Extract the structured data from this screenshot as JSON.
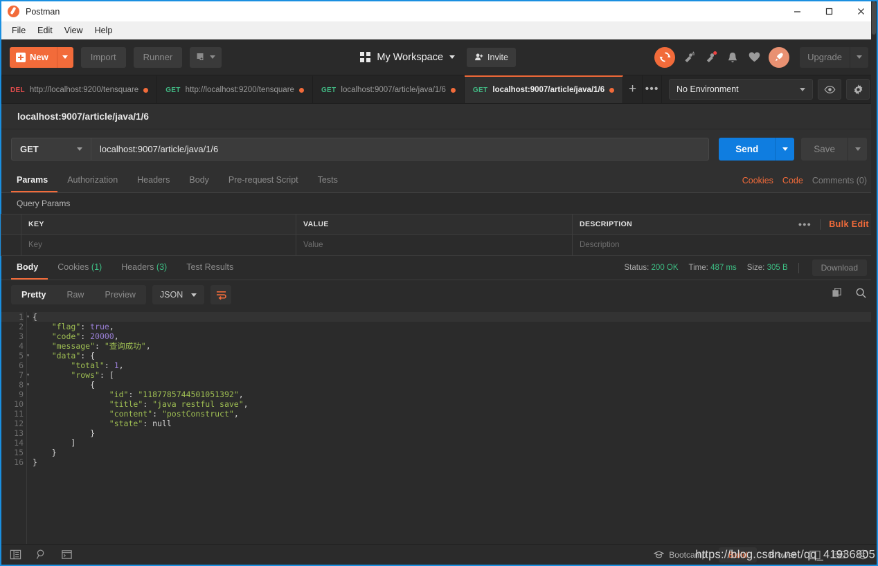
{
  "window": {
    "title": "Postman",
    "logo_icon": "postman-logo-icon",
    "minimize_icon": "minimize-icon",
    "maximize_icon": "maximize-icon",
    "close_icon": "close-icon"
  },
  "menubar": {
    "items": [
      "File",
      "Edit",
      "View",
      "Help"
    ]
  },
  "toolbar": {
    "new_label": "New",
    "new_caret_icon": "chevron-down-icon",
    "import_label": "Import",
    "runner_label": "Runner",
    "new_window_icon": "new-window-icon",
    "workspace_label": "My Workspace",
    "workspace_grid_icon": "grid-icon",
    "workspace_caret_icon": "chevron-down-icon",
    "invite_label": "Invite",
    "invite_icon": "person-add-icon",
    "sync_icon": "sync-icon",
    "satellite_icon": "satellite-icon",
    "notifications_icon": "notification-bell-alert-icon",
    "bell_icon": "bell-icon",
    "heart_icon": "heart-icon",
    "rocket_icon": "rocket-icon",
    "upgrade_label": "Upgrade",
    "upgrade_caret_icon": "chevron-down-icon"
  },
  "tabs": [
    {
      "verb": "DEL",
      "verb_class": "del",
      "label": "http://localhost:9200/tensquare",
      "unsaved": true,
      "active": false
    },
    {
      "verb": "GET",
      "verb_class": "get",
      "label": "http://localhost:9200/tensquare",
      "unsaved": true,
      "active": false
    },
    {
      "verb": "GET",
      "verb_class": "get",
      "label": "localhost:9007/article/java/1/6",
      "unsaved": true,
      "active": false
    },
    {
      "verb": "GET",
      "verb_class": "get",
      "label": "localhost:9007/article/java/1/6",
      "unsaved": true,
      "active": true
    }
  ],
  "tab_controls": {
    "add_icon": "plus-icon",
    "more_icon": "ellipsis-icon"
  },
  "environment": {
    "selected": "No Environment",
    "caret_icon": "chevron-down-icon",
    "eye_icon": "eye-icon",
    "gear_icon": "gear-icon"
  },
  "request": {
    "name": "localhost:9007/article/java/1/6",
    "method": "GET",
    "method_caret_icon": "chevron-down-icon",
    "url": "localhost:9007/article/java/1/6",
    "send_label": "Send",
    "send_caret_icon": "chevron-down-icon",
    "save_label": "Save",
    "save_caret_icon": "chevron-down-icon",
    "tabs": [
      {
        "label": "Params",
        "active": true
      },
      {
        "label": "Authorization",
        "active": false
      },
      {
        "label": "Headers",
        "active": false
      },
      {
        "label": "Body",
        "active": false
      },
      {
        "label": "Pre-request Script",
        "active": false
      },
      {
        "label": "Tests",
        "active": false
      }
    ],
    "cookies_link": "Cookies",
    "code_link": "Code",
    "comments_link": "Comments (0)"
  },
  "query_params": {
    "title": "Query Params",
    "columns": [
      "KEY",
      "VALUE",
      "DESCRIPTION"
    ],
    "more_icon": "ellipsis-icon",
    "bulk_edit_label": "Bulk Edit",
    "placeholder_row": {
      "key": "Key",
      "value": "Value",
      "description": "Description"
    }
  },
  "response": {
    "tabs": [
      {
        "label": "Body",
        "active": true
      },
      {
        "label": "Cookies",
        "count": "(1)",
        "active": false
      },
      {
        "label": "Headers",
        "count": "(3)",
        "active": false
      },
      {
        "label": "Test Results",
        "active": false
      }
    ],
    "status_label": "Status:",
    "status_value": "200 OK",
    "time_label": "Time:",
    "time_value": "487 ms",
    "size_label": "Size:",
    "size_value": "305 B",
    "download_label": "Download",
    "view_modes": [
      {
        "label": "Pretty",
        "active": true
      },
      {
        "label": "Raw",
        "active": false
      },
      {
        "label": "Preview",
        "active": false
      }
    ],
    "format": "JSON",
    "format_caret_icon": "chevron-down-icon",
    "wrap_icon": "word-wrap-icon",
    "copy_icon": "copy-icon",
    "search_icon": "search-icon",
    "body_lines": [
      {
        "n": 1,
        "fold": true,
        "indent": 0,
        "tokens": [
          {
            "t": "{",
            "c": "p"
          }
        ]
      },
      {
        "n": 2,
        "fold": false,
        "indent": 1,
        "tokens": [
          {
            "t": "\"flag\"",
            "c": "k"
          },
          {
            "t": ": ",
            "c": "p"
          },
          {
            "t": "true",
            "c": "b"
          },
          {
            "t": ",",
            "c": "p"
          }
        ]
      },
      {
        "n": 3,
        "fold": false,
        "indent": 1,
        "tokens": [
          {
            "t": "\"code\"",
            "c": "k"
          },
          {
            "t": ": ",
            "c": "p"
          },
          {
            "t": "20000",
            "c": "n"
          },
          {
            "t": ",",
            "c": "p"
          }
        ]
      },
      {
        "n": 4,
        "fold": false,
        "indent": 1,
        "tokens": [
          {
            "t": "\"message\"",
            "c": "k"
          },
          {
            "t": ": ",
            "c": "p"
          },
          {
            "t": "\"查询成功\"",
            "c": "s"
          },
          {
            "t": ",",
            "c": "p"
          }
        ]
      },
      {
        "n": 5,
        "fold": true,
        "indent": 1,
        "tokens": [
          {
            "t": "\"data\"",
            "c": "k"
          },
          {
            "t": ": {",
            "c": "p"
          }
        ]
      },
      {
        "n": 6,
        "fold": false,
        "indent": 2,
        "tokens": [
          {
            "t": "\"total\"",
            "c": "k"
          },
          {
            "t": ": ",
            "c": "p"
          },
          {
            "t": "1",
            "c": "n"
          },
          {
            "t": ",",
            "c": "p"
          }
        ]
      },
      {
        "n": 7,
        "fold": true,
        "indent": 2,
        "tokens": [
          {
            "t": "\"rows\"",
            "c": "k"
          },
          {
            "t": ": [",
            "c": "p"
          }
        ]
      },
      {
        "n": 8,
        "fold": true,
        "indent": 3,
        "tokens": [
          {
            "t": "{",
            "c": "p"
          }
        ]
      },
      {
        "n": 9,
        "fold": false,
        "indent": 4,
        "tokens": [
          {
            "t": "\"id\"",
            "c": "k"
          },
          {
            "t": ": ",
            "c": "p"
          },
          {
            "t": "\"1187785744501051392\"",
            "c": "s"
          },
          {
            "t": ",",
            "c": "p"
          }
        ]
      },
      {
        "n": 10,
        "fold": false,
        "indent": 4,
        "tokens": [
          {
            "t": "\"title\"",
            "c": "k"
          },
          {
            "t": ": ",
            "c": "p"
          },
          {
            "t": "\"java restful save\"",
            "c": "s"
          },
          {
            "t": ",",
            "c": "p"
          }
        ]
      },
      {
        "n": 11,
        "fold": false,
        "indent": 4,
        "tokens": [
          {
            "t": "\"content\"",
            "c": "k"
          },
          {
            "t": ": ",
            "c": "p"
          },
          {
            "t": "\"postConstruct\"",
            "c": "s"
          },
          {
            "t": ",",
            "c": "p"
          }
        ]
      },
      {
        "n": 12,
        "fold": false,
        "indent": 4,
        "tokens": [
          {
            "t": "\"state\"",
            "c": "k"
          },
          {
            "t": ": ",
            "c": "p"
          },
          {
            "t": "null",
            "c": "nl"
          }
        ]
      },
      {
        "n": 13,
        "fold": false,
        "indent": 3,
        "tokens": [
          {
            "t": "}",
            "c": "p"
          }
        ]
      },
      {
        "n": 14,
        "fold": false,
        "indent": 2,
        "tokens": [
          {
            "t": "]",
            "c": "p"
          }
        ]
      },
      {
        "n": 15,
        "fold": false,
        "indent": 1,
        "tokens": [
          {
            "t": "}",
            "c": "p"
          }
        ]
      },
      {
        "n": 16,
        "fold": false,
        "indent": 0,
        "tokens": [
          {
            "t": "}",
            "c": "p"
          }
        ]
      }
    ]
  },
  "statusbar": {
    "sidebar_toggle_icon": "sidebar-toggle-icon",
    "find_icon": "search-icon",
    "console_icon": "console-icon",
    "bootcamp_label": "Bootcamp",
    "bootcamp_icon": "graduation-cap-icon",
    "build_label": "Build",
    "browse_label": "Browse",
    "layout_icon": "two-pane-icon",
    "keyboard_icon": "keyboard-icon",
    "smiley_icon": "smiley-icon",
    "watermark": "https://blog.csdn.net/qq_41936805"
  }
}
